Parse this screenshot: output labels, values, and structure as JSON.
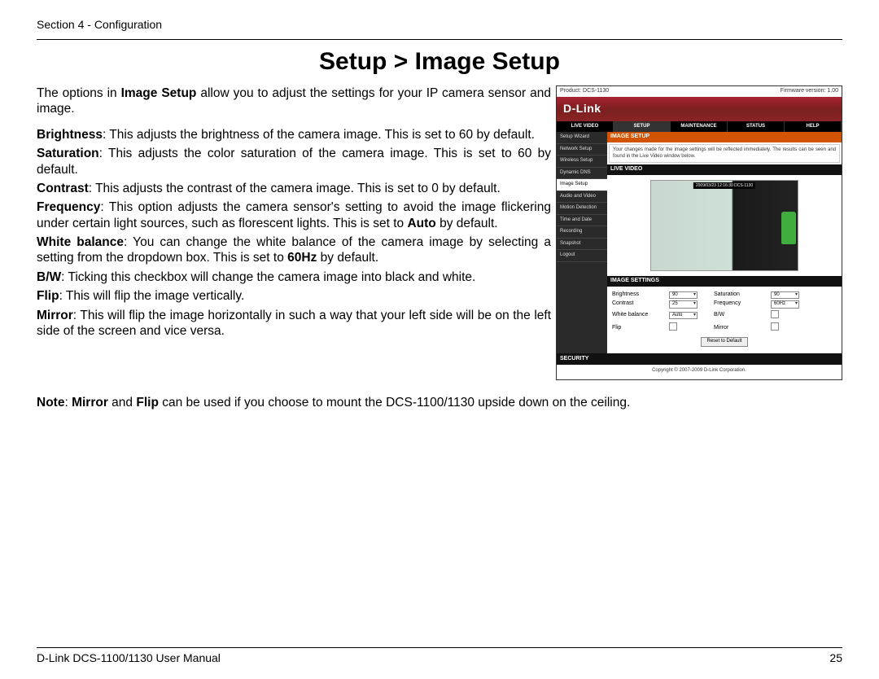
{
  "header": {
    "section": "Section 4 - Configuration"
  },
  "title": "Setup > Image Setup",
  "intro": {
    "pre": "The options in ",
    "bold": "Image Setup",
    "post": " allow you to adjust the settings for your IP camera sensor and image."
  },
  "defs": {
    "brightness": {
      "term": "Brightness",
      "text": ": This adjusts the brightness of the camera image. This is set to 60 by default."
    },
    "saturation": {
      "term": "Saturation",
      "text": ": This adjusts the color saturation of the camera image. This is set to 60 by default."
    },
    "contrast": {
      "term": "Contrast",
      "text": ": This adjusts the contrast of the camera image. This is set to 0 by default."
    },
    "frequency": {
      "term": "Frequency",
      "text_a": ": This option adjusts the camera sensor's setting to avoid the image flickering under certain light sources, such as florescent lights. This is set to ",
      "bold": "Auto",
      "text_b": " by default."
    },
    "whitebal": {
      "term": "White balance",
      "text_a": ": You can change the white balance of the camera image by selecting a setting from the dropdown box. This is set to ",
      "bold": "60Hz",
      "text_b": " by default."
    },
    "bw": {
      "term": "B/W",
      "text": ": Ticking this checkbox will change the camera image into black and white."
    },
    "flip": {
      "term": "Flip",
      "text": ": This will flip the image vertically."
    },
    "mirror": {
      "term": "Mirror",
      "text": ": This will flip the image horizontally in such a way that your left side will be on the left side of the screen and vice versa."
    }
  },
  "note": {
    "lead": "Note",
    "sep": ": ",
    "m": "Mirror",
    "mid": " and ",
    "f": "Flip",
    "tail": " can be used if you choose to mount the DCS-1100/1130 upside down on the ceiling."
  },
  "figure": {
    "product": "Product: DCS-1130",
    "fw": "Firmware version: 1.00",
    "brand": "D-Link",
    "tabs": [
      "LIVE VIDEO",
      "SETUP",
      "MAINTENANCE",
      "STATUS",
      "HELP"
    ],
    "side": [
      "Setup Wizard",
      "Network Setup",
      "Wireless Setup",
      "Dynamic DNS",
      "Image Setup",
      "Audio and Video",
      "Motion Detection",
      "Time and Date",
      "Recording",
      "Snapshot",
      "Logout"
    ],
    "panel_title": "IMAGE SETUP",
    "panel_note": "Your changes made for the image settings will be reflected immediately. The results can be seen and found in the Live Video window below.",
    "live_hd": "LIVE VIDEO",
    "timestamp": "2009/03/23 12:16:30 DCS-1130",
    "settings_hd": "IMAGE SETTINGS",
    "rows": {
      "brightness": {
        "l": "Brightness",
        "v": "90"
      },
      "saturation": {
        "l": "Saturation",
        "v": "90"
      },
      "contrast": {
        "l": "Contrast",
        "v": "25"
      },
      "frequency": {
        "l": "Frequency",
        "v": "60Hz"
      },
      "whitebal": {
        "l": "White balance",
        "v": "Auto"
      },
      "bw": {
        "l": "B/W"
      },
      "flip": {
        "l": "Flip"
      },
      "mirror": {
        "l": "Mirror"
      }
    },
    "reset_btn": "Reset to Default",
    "security": "SECURITY",
    "copyright": "Copyright © 2007-2009 D-Link Corporation."
  },
  "footer": {
    "left": "D-Link DCS-1100/1130 User Manual",
    "right": "25"
  }
}
